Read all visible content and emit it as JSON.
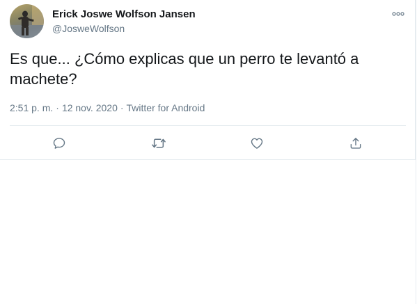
{
  "author": {
    "name": "Erick Joswe Wolfson Jansen",
    "handle": "@JosweWolfson"
  },
  "tweet": {
    "text": "Es que... ¿Cómo explicas que un perro te levantó a machete?",
    "time": "2:51 p. m.",
    "date": "12 nov. 2020",
    "source": "Twitter for Android"
  },
  "icons": {
    "more": "more-horizontal-icon",
    "reply": "reply-icon",
    "retweet": "retweet-icon",
    "like": "heart-icon",
    "share": "share-icon"
  },
  "colors": {
    "text": "#14171a",
    "secondary": "#657786",
    "border": "#e6ecf0"
  }
}
